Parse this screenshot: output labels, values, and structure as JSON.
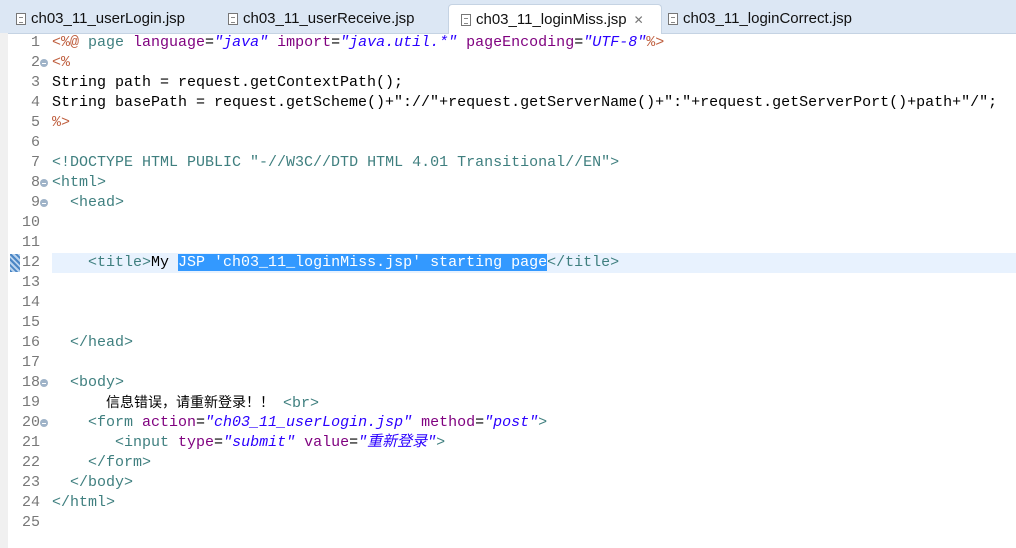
{
  "tabs": [
    {
      "label": "ch03_11_userLogin.jsp",
      "active": false
    },
    {
      "label": "ch03_11_userReceive.jsp",
      "active": false
    },
    {
      "label": "ch03_11_loginMiss.jsp",
      "active": true,
      "close_icon": "close-icon"
    },
    {
      "label": "ch03_11_loginCorrect.jsp",
      "active": false
    }
  ],
  "editor": {
    "current_line": 12,
    "lines": [
      {
        "n": "1",
        "tokens": [
          [
            "<%@ ",
            "jsp"
          ],
          [
            "page ",
            "dir"
          ],
          [
            "language",
            "attr"
          ],
          [
            "=",
            "plain"
          ],
          [
            "\"java\"",
            "val"
          ],
          [
            " ",
            "plain"
          ],
          [
            "import",
            "attr"
          ],
          [
            "=",
            "plain"
          ],
          [
            "\"java.util.*\"",
            "val"
          ],
          [
            " ",
            "plain"
          ],
          [
            "pageEncoding",
            "attr"
          ],
          [
            "=",
            "plain"
          ],
          [
            "\"UTF-8\"",
            "val"
          ],
          [
            "%>",
            "jsp"
          ]
        ]
      },
      {
        "n": "2",
        "fold": true,
        "tokens": [
          [
            "<%",
            "jsp"
          ]
        ]
      },
      {
        "n": "3",
        "tokens": [
          [
            "String path = request.getContextPath();",
            "plain"
          ]
        ]
      },
      {
        "n": "4",
        "tokens": [
          [
            "String basePath = request.getScheme()+\"://\"+request.getServerName()+\":\"+request.getServerPort()+path+\"/\";",
            "plain"
          ]
        ]
      },
      {
        "n": "5",
        "tokens": [
          [
            "%>",
            "jsp"
          ]
        ]
      },
      {
        "n": "6",
        "tokens": []
      },
      {
        "n": "7",
        "tokens": [
          [
            "<!DOCTYPE HTML PUBLIC ",
            "dt"
          ],
          [
            "\"-//W3C//DTD HTML 4.01 Transitional//EN\"",
            "tag"
          ],
          [
            ">",
            "dt"
          ]
        ]
      },
      {
        "n": "8",
        "fold": true,
        "tokens": [
          [
            "<html>",
            "tag"
          ]
        ]
      },
      {
        "n": "9",
        "fold": true,
        "tokens": [
          [
            "  <head>",
            "tag"
          ]
        ]
      },
      {
        "n": "10",
        "tokens": []
      },
      {
        "n": "11",
        "tokens": []
      },
      {
        "n": "12",
        "tokens": [
          [
            "    <title>",
            "tag"
          ],
          [
            "My ",
            "plain"
          ],
          [
            "JSP 'ch03_11_loginMiss.jsp' starting page",
            "sel"
          ],
          [
            "</title>",
            "tag"
          ]
        ]
      },
      {
        "n": "13",
        "tokens": []
      },
      {
        "n": "14",
        "tokens": []
      },
      {
        "n": "15",
        "tokens": []
      },
      {
        "n": "16",
        "tokens": [
          [
            "  </head>",
            "tag"
          ]
        ]
      },
      {
        "n": "17",
        "tokens": []
      },
      {
        "n": "18",
        "fold": true,
        "tokens": [
          [
            "  <body>",
            "tag"
          ]
        ]
      },
      {
        "n": "19",
        "tokens": [
          [
            "      ",
            "plain"
          ],
          [
            "信息错误，请重新登录！！",
            "cjk"
          ],
          [
            " ",
            "plain"
          ],
          [
            "<br>",
            "tag"
          ]
        ]
      },
      {
        "n": "20",
        "fold": true,
        "tokens": [
          [
            "    <form ",
            "tag"
          ],
          [
            "action",
            "attr"
          ],
          [
            "=",
            "plain"
          ],
          [
            "\"ch03_11_userLogin.jsp\"",
            "val"
          ],
          [
            " ",
            "plain"
          ],
          [
            "method",
            "attr"
          ],
          [
            "=",
            "plain"
          ],
          [
            "\"post\"",
            "val"
          ],
          [
            ">",
            "tag"
          ]
        ]
      },
      {
        "n": "21",
        "tokens": [
          [
            "       <input ",
            "tag"
          ],
          [
            "type",
            "attr"
          ],
          [
            "=",
            "plain"
          ],
          [
            "\"submit\"",
            "val"
          ],
          [
            " ",
            "plain"
          ],
          [
            "value",
            "attr"
          ],
          [
            "=",
            "plain"
          ],
          [
            "\"重新登录\"",
            "val"
          ],
          [
            ">",
            "tag"
          ]
        ]
      },
      {
        "n": "22",
        "tokens": [
          [
            "    </form>",
            "tag"
          ]
        ]
      },
      {
        "n": "23",
        "tokens": [
          [
            "  </body>",
            "tag"
          ]
        ]
      },
      {
        "n": "24",
        "tokens": [
          [
            "</html>",
            "tag"
          ]
        ]
      },
      {
        "n": "25",
        "tokens": []
      }
    ]
  }
}
